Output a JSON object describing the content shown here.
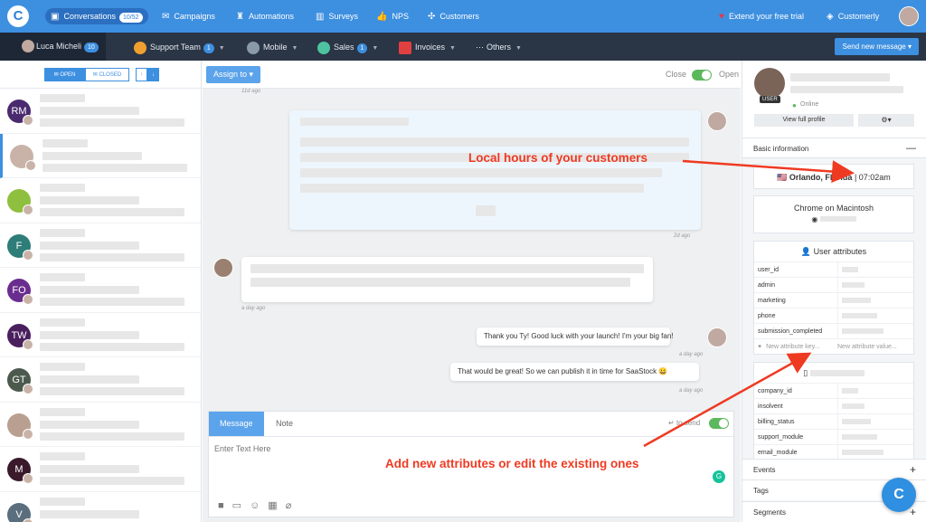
{
  "topbar": {
    "logo": "C",
    "items": [
      {
        "label": "Conversations",
        "icon": "chat-icon",
        "badge": "10/52"
      },
      {
        "label": "Campaigns",
        "icon": "envelope-icon"
      },
      {
        "label": "Automations",
        "icon": "robot-icon"
      },
      {
        "label": "Surveys",
        "icon": "chart-icon"
      },
      {
        "label": "NPS",
        "icon": "thumb-up-icon"
      },
      {
        "label": "Customers",
        "icon": "people-icon"
      }
    ],
    "trial_label": "Extend your free trial",
    "account_label": "Customerly"
  },
  "subbar": {
    "tabs": [
      {
        "label": "Luca Micheli",
        "count": "10"
      },
      {
        "label": "Support Team",
        "count": "1"
      },
      {
        "label": "Mobile",
        "count": ""
      },
      {
        "label": "Sales",
        "count": "1"
      },
      {
        "label": "Invoices",
        "count": ""
      },
      {
        "label": "Others",
        "count": ""
      }
    ],
    "send_label": "Send new message"
  },
  "inbox": {
    "open_label": "OPEN",
    "closed_label": "CLOSED",
    "conversations": [
      {
        "initials": "RM",
        "color": "#4a2a6e"
      },
      {
        "initials": "",
        "color": "#c9b3a8"
      },
      {
        "initials": "",
        "color": "#8fbf3f"
      },
      {
        "initials": "F",
        "color": "#2e7d78"
      },
      {
        "initials": "FO",
        "color": "#6a2d8f"
      },
      {
        "initials": "TW",
        "color": "#4a1f5e"
      },
      {
        "initials": "GT",
        "color": "#4c5a4e"
      },
      {
        "initials": "",
        "color": "#b99f90"
      },
      {
        "initials": "M",
        "color": "#3a1a2a"
      },
      {
        "initials": "V",
        "color": "#5a6e7e"
      }
    ]
  },
  "chat": {
    "assign_label": "Assign to",
    "close_label": "Close",
    "open_label": "Open",
    "messages": [
      {
        "time": "11d ago"
      },
      {
        "time": "2d ago"
      },
      {
        "time": "a day ago"
      },
      {
        "text": "Thank you Ty! Good luck with your launch! I'm your big fan!",
        "time": "a day ago"
      },
      {
        "text": "That would be great! So we can publish it in time for SaaStock 😀",
        "time": "a day ago"
      }
    ],
    "composer": {
      "tab_message": "Message",
      "tab_note": "Note",
      "send_hint": "to send",
      "placeholder": "Enter Text Here"
    }
  },
  "profile": {
    "user_badge": "USER",
    "status": "Online",
    "view_profile_label": "View full profile",
    "basic_info_label": "Basic information",
    "location": "Orlando, Florida",
    "local_time": "07:02am",
    "browser": "Chrome on Macintosh",
    "user_attributes_label": "User attributes",
    "user_attributes": [
      "user_id",
      "admin",
      "marketing",
      "phone",
      "submission_completed"
    ],
    "new_attr_key_placeholder": "New attribute key...",
    "new_attr_value_placeholder": "New attribute value...",
    "company_attributes": [
      "company_id",
      "insolvent",
      "billing_status",
      "support_module",
      "email_module"
    ],
    "sections": [
      "Events",
      "Tags",
      "Segments"
    ]
  },
  "annotations": {
    "local_hours": "Local hours of your customers",
    "add_attributes": "Add new attributes or edit the existing ones"
  }
}
